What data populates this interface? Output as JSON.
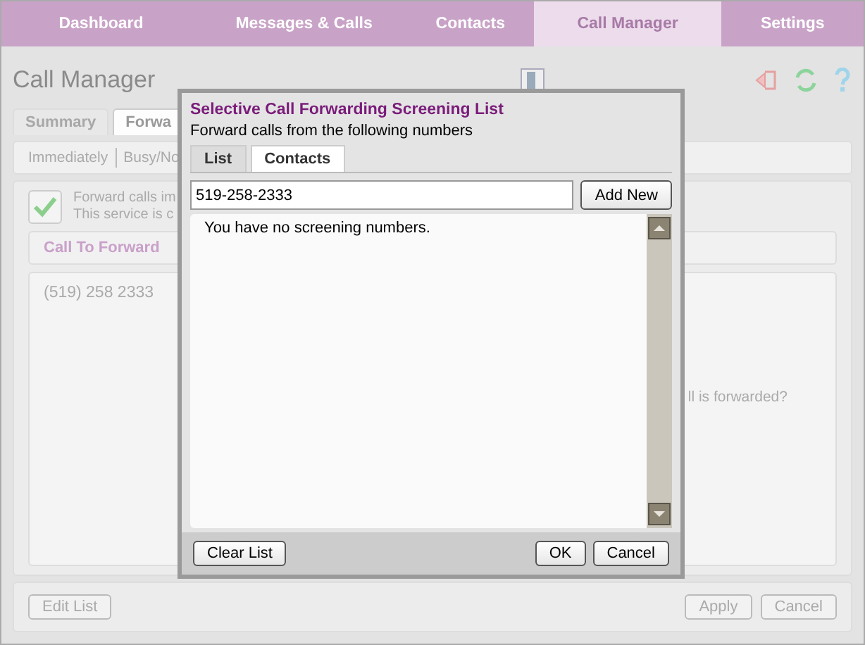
{
  "nav": [
    {
      "label": "Dashboard",
      "selected": false
    },
    {
      "label": "Messages & Calls",
      "selected": false
    },
    {
      "label": "Contacts",
      "selected": false
    },
    {
      "label": "Call Manager",
      "selected": true
    },
    {
      "label": "Settings",
      "selected": false
    }
  ],
  "page": {
    "title": "Call Manager",
    "tabs": [
      {
        "label": "Summary",
        "selected": false
      },
      {
        "label": "Forwa",
        "selected": true
      }
    ],
    "filters": [
      "Immediately",
      "Busy/No"
    ],
    "forward": {
      "checked": true,
      "line1": "Forward calls im",
      "line2": "This service is c"
    },
    "section_header": "Call To Forward",
    "number": "(519) 258 2333",
    "question": "ll is forwarded?",
    "edit_button": "Edit List",
    "apply_button": "Apply",
    "cancel_button": "Cancel"
  },
  "dialog": {
    "title": "Selective Call Forwarding Screening List",
    "subtitle": "Forward calls from the following numbers",
    "tabs": [
      {
        "label": "List",
        "selected": true
      },
      {
        "label": "Contacts",
        "selected": false
      }
    ],
    "input_value": "519-258-2333",
    "add_button": "Add New",
    "empty_message": "You have no screening numbers.",
    "clear_button": "Clear List",
    "ok_button": "OK",
    "cancel_button": "Cancel"
  }
}
